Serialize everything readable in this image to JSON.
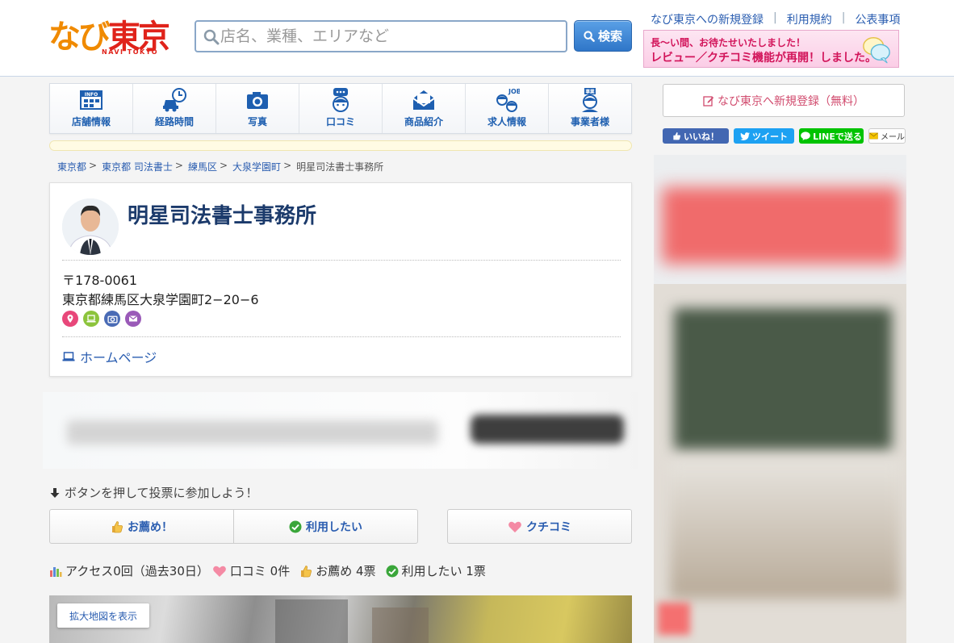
{
  "header": {
    "logo_main": "なび東京",
    "logo_sub": "NAVI TOKYO",
    "search_placeholder": "店名、業種、エリアなど",
    "search_button": "検索",
    "links": [
      "なび東京への新規登録",
      "利用規約",
      "公表事項"
    ],
    "banner_line1": "長〜い間、お待たせいたしました！",
    "banner_line2": "レビュー／クチコミ機能が再開！しました。"
  },
  "tabs": [
    {
      "label": "店舗情報",
      "icon": "info-icon"
    },
    {
      "label": "経路時間",
      "icon": "car-clock-icon"
    },
    {
      "label": "写真",
      "icon": "camera-icon"
    },
    {
      "label": "口コミ",
      "icon": "speech-person-icon"
    },
    {
      "label": "商品紹介",
      "icon": "envelope-icon"
    },
    {
      "label": "求人情報",
      "icon": "job-icon"
    },
    {
      "label": "事業者様",
      "icon": "business-person-icon"
    }
  ],
  "breadcrumbs": {
    "items": [
      "東京都",
      "東京都 司法書士",
      "練馬区",
      "大泉学園町"
    ],
    "separator": ">",
    "current": "明星司法書士事務所"
  },
  "shop": {
    "name": "明星司法書士事務所",
    "zip": "〒178-0061",
    "address": "東京都練馬区大泉学園町2−20−6",
    "contact_icons": [
      {
        "icon": "map-pin-icon",
        "color": "#e8477a"
      },
      {
        "icon": "laptop-icon",
        "color": "#8cc43c"
      },
      {
        "icon": "camera-icon",
        "color": "#4a6bb5"
      },
      {
        "icon": "mail-icon",
        "color": "#9a5ab8"
      }
    ],
    "homepage_label": "ホームページ"
  },
  "vote": {
    "hint": "ボタンを押して投票に参加しよう！",
    "recommend_button": "お薦め！",
    "want_button": "利用したい",
    "kuchikomi_button": "クチコミ"
  },
  "stats": {
    "access": "アクセス0回（過去30日）",
    "kuchikomi": "口コミ 0件",
    "recommend": "お薦め 4票",
    "want": "利用したい 1票"
  },
  "map": {
    "expand_button": "拡大地図を表示"
  },
  "sidebar": {
    "register_button": "なび東京へ新規登録（無料）",
    "social": {
      "like": "いいね！",
      "tweet": "ツイート",
      "line": "LINEで送る",
      "mail": "メール"
    }
  },
  "colors": {
    "link_blue": "#2a5db0",
    "title_navy": "#1b3a6b",
    "brand_red": "#e0231b",
    "brand_orange": "#f08a00",
    "register_pink": "#d14b6e"
  }
}
